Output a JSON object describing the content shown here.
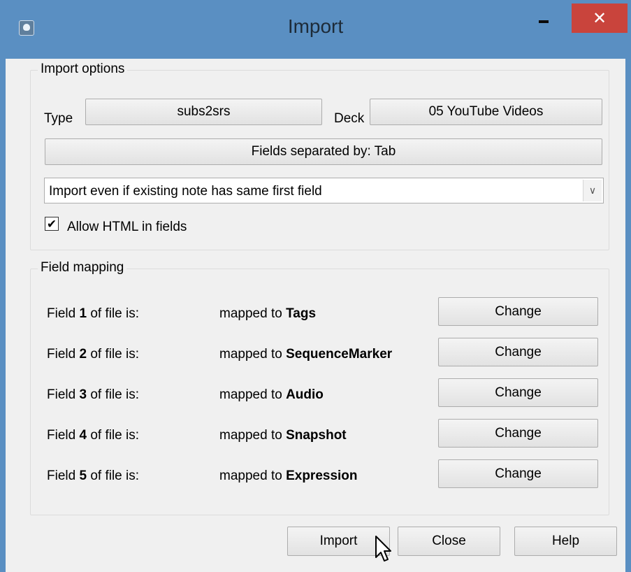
{
  "window": {
    "title": "Import",
    "close_glyph": "✕"
  },
  "import_options": {
    "group_label": "Import options",
    "type_label": "Type",
    "type_value": "subs2srs",
    "deck_label": "Deck",
    "deck_value": "05 YouTube Videos",
    "separator_button": "Fields separated by: Tab",
    "duplicate_mode": "Import even if existing note has same first field",
    "allow_html_label": "Allow HTML in fields",
    "allow_html_checked": true
  },
  "field_mapping": {
    "group_label": "Field mapping",
    "rows": [
      {
        "prefix": "Field ",
        "num": "1",
        "suffix": " of file is:",
        "mapped_prefix": "mapped to ",
        "target": "Tags",
        "button": "Change"
      },
      {
        "prefix": "Field ",
        "num": "2",
        "suffix": " of file is:",
        "mapped_prefix": "mapped to ",
        "target": "SequenceMarker",
        "button": "Change"
      },
      {
        "prefix": "Field ",
        "num": "3",
        "suffix": " of file is:",
        "mapped_prefix": "mapped to ",
        "target": "Audio",
        "button": "Change"
      },
      {
        "prefix": "Field ",
        "num": "4",
        "suffix": " of file is:",
        "mapped_prefix": "mapped to ",
        "target": "Snapshot",
        "button": "Change"
      },
      {
        "prefix": "Field ",
        "num": "5",
        "suffix": " of file is:",
        "mapped_prefix": "mapped to ",
        "target": "Expression",
        "button": "Change"
      }
    ]
  },
  "buttons": {
    "import": "Import",
    "close": "Close",
    "help": "Help"
  },
  "colors": {
    "titlebar": "#5a8fc2",
    "close_button": "#c9443c",
    "dialog_bg": "#f0f0f0"
  }
}
